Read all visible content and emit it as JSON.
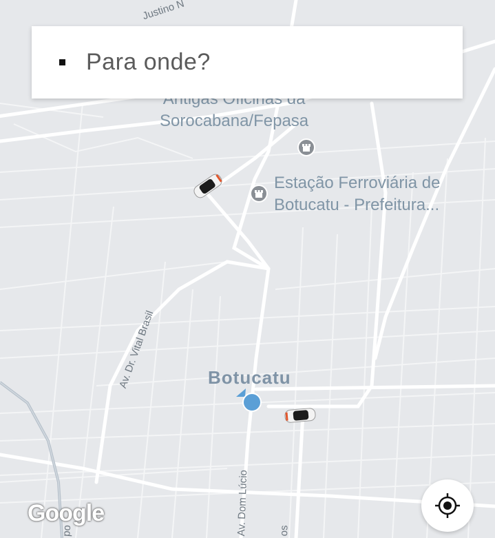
{
  "search": {
    "placeholder_text": "Para onde?"
  },
  "map": {
    "poi_1": {
      "line1": "Antigas Oficinas da",
      "line2": "Sorocabana/Fepasa"
    },
    "poi_2": {
      "line1": "Estação Ferroviária de",
      "line2": "Botucatu - Prefeitura..."
    },
    "city": "Botucatu",
    "streets": {
      "justino": "Justino N",
      "vital_brasil": "Av. Dr. Vital Brasil",
      "dom_lucio": "Av. Dom Lúcio",
      "left_edge": "po",
      "bottom": "os"
    },
    "attribution": "Google"
  },
  "colors": {
    "map_background": "#e6e8eb",
    "road": "#ffffff",
    "user_location": "#5b9fd6"
  },
  "icons": {
    "locate": "locate-icon",
    "poi": "landmark-icon",
    "car": "car-icon"
  }
}
